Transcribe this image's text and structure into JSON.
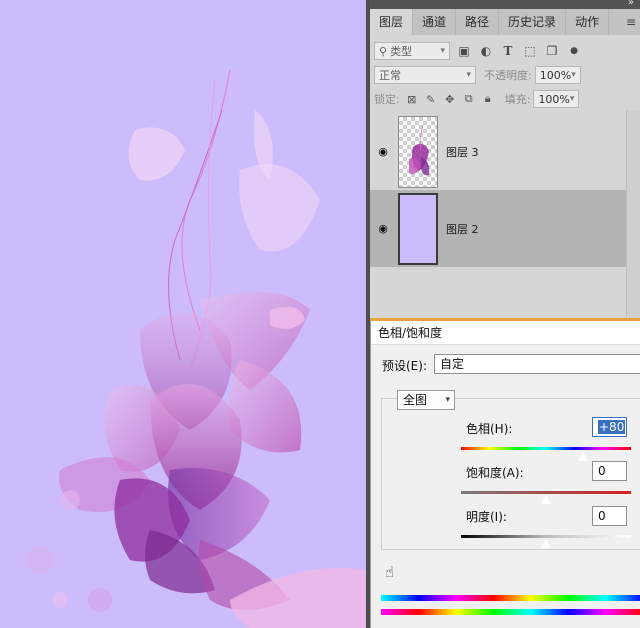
{
  "panel": {
    "tabs": [
      "图层",
      "通道",
      "路径",
      "历史记录",
      "动作"
    ],
    "active_tab": "图层",
    "filter_label": "类型",
    "blend_mode": "正常",
    "opacity_label": "不透明度:",
    "opacity_value": "100%",
    "lock_label": "锁定:",
    "fill_label": "填充:",
    "fill_value": "100%",
    "layers": [
      {
        "name": "图层 3",
        "selected": false,
        "visible": true
      },
      {
        "name": "图层 2",
        "selected": true,
        "visible": true
      }
    ],
    "icons": [
      "search-icon",
      "image-filter-icon",
      "adjustment-filter-icon",
      "type-filter-icon",
      "shape-filter-icon",
      "smart-object-filter-icon",
      "filter-toggle-icon",
      "lock-transparent-icon",
      "lock-image-icon",
      "lock-position-icon",
      "lock-artboard-icon",
      "lock-all-icon",
      "eye-icon",
      "panel-menu-icon"
    ]
  },
  "dialog": {
    "title": "色相/饱和度",
    "preset_label": "预设(E):",
    "preset_value": "自定",
    "channel_value": "全图",
    "hue_label": "色相(H):",
    "hue_value": "+80",
    "saturation_label": "饱和度(A):",
    "saturation_value": "0",
    "lightness_label": "明度(I):",
    "lightness_value": "0",
    "hue_level": 0.72,
    "saturation_level": 0.5,
    "lightness_level": 0.5,
    "icons": [
      "hand-adjust-icon"
    ]
  },
  "colors": {
    "canvas_bg": "#cdbcfb",
    "panel_bg": "#d6d6d6",
    "selected_layer": "#b4b4b4",
    "dialog_bg": "#f0f0f0",
    "accent": "#e9a23b"
  }
}
